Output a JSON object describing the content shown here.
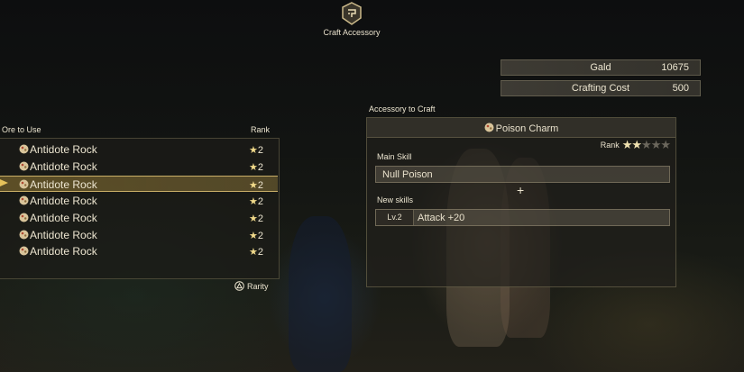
{
  "header": {
    "title": "Craft Accessory",
    "emblem_icon": "craft-emblem-icon"
  },
  "currency": {
    "gald_label": "Gald",
    "gald_value": "10675",
    "cost_label": "Crafting Cost",
    "cost_value": "500"
  },
  "ore_list": {
    "col_ore": "Ore to Use",
    "col_rank": "Rank",
    "items": [
      {
        "name": "Antidote Rock",
        "rank": "2"
      },
      {
        "name": "Antidote Rock",
        "rank": "2"
      },
      {
        "name": "Antidote Rock",
        "rank": "2"
      },
      {
        "name": "Antidote Rock",
        "rank": "2"
      },
      {
        "name": "Antidote Rock",
        "rank": "2"
      },
      {
        "name": "Antidote Rock",
        "rank": "2"
      },
      {
        "name": "Antidote Rock",
        "rank": "2"
      }
    ],
    "selected_index": 2,
    "rank_star": "★",
    "rarity_label": "Rarity"
  },
  "craft": {
    "heading": "Accessory to Craft",
    "name": "Poison Charm",
    "rank_label": "Rank",
    "rank_filled": 2,
    "rank_max": 5,
    "main_skill_label": "Main Skill",
    "main_skill": "Null Poison",
    "new_skills_label": "New skills",
    "new_skill_level": "Lv.2",
    "new_skill": "Attack +20",
    "plus_glyph": "+"
  },
  "colors": {
    "accent_gold": "#e6c25a",
    "star": "#f0d98a"
  }
}
